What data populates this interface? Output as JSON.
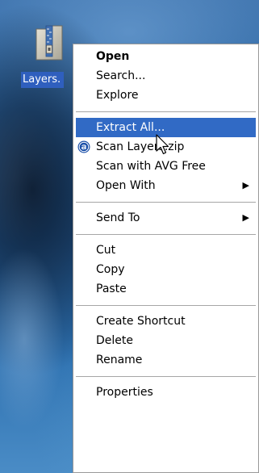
{
  "desktop": {
    "icon": {
      "name": "zip-folder-icon",
      "label": "Layers."
    }
  },
  "context_menu": {
    "selected_color": "#316ac5",
    "groups": [
      [
        {
          "label": "Open",
          "bold": true
        },
        {
          "label": "Search..."
        },
        {
          "label": "Explore"
        }
      ],
      [
        {
          "label": "Extract All...",
          "selected": true
        },
        {
          "label": "Scan Layers.zip",
          "icon": "avast-icon"
        },
        {
          "label": "Scan with AVG Free"
        },
        {
          "label": "Open With",
          "submenu": true
        }
      ],
      [
        {
          "label": "Send To",
          "submenu": true
        }
      ],
      [
        {
          "label": "Cut"
        },
        {
          "label": "Copy"
        },
        {
          "label": "Paste"
        }
      ],
      [
        {
          "label": "Create Shortcut"
        },
        {
          "label": "Delete"
        },
        {
          "label": "Rename"
        }
      ],
      [
        {
          "label": "Properties"
        }
      ]
    ]
  },
  "cursor": {
    "icon": "arrow-pointer-icon"
  }
}
